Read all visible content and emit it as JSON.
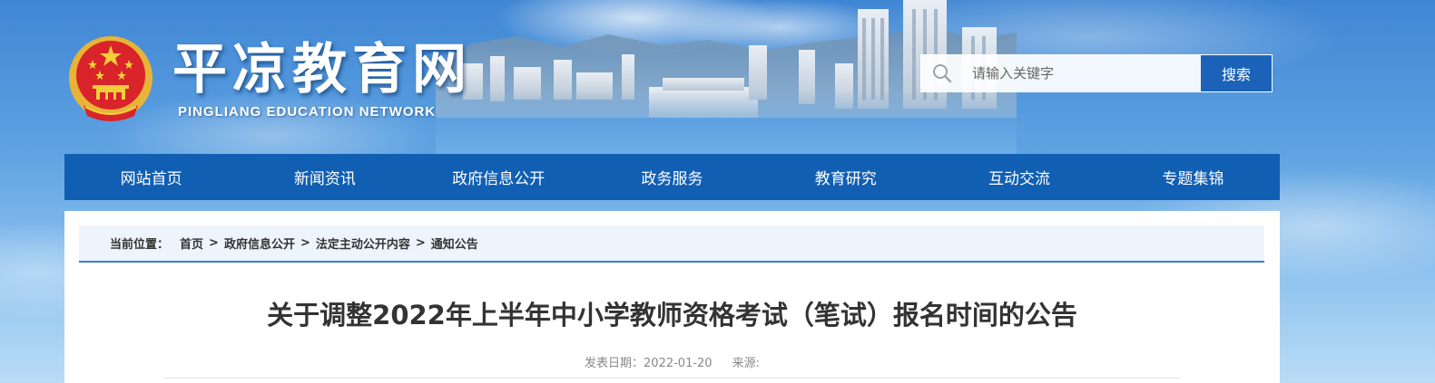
{
  "header": {
    "site_title": "平凉教育网",
    "site_subtitle": "PINGLIANG EDUCATION NETWORK",
    "emblem_icon": "national-emblem-icon"
  },
  "search": {
    "placeholder": "请输入关键字",
    "button_label": "搜索",
    "icon": "search-icon"
  },
  "nav": {
    "items": [
      {
        "label": "网站首页"
      },
      {
        "label": "新闻资讯"
      },
      {
        "label": "政府信息公开"
      },
      {
        "label": "政务服务"
      },
      {
        "label": "教育研究"
      },
      {
        "label": "互动交流"
      },
      {
        "label": "专题集锦"
      }
    ]
  },
  "breadcrumb": {
    "label": "当前位置：",
    "items": [
      "首页",
      "政府信息公开",
      "法定主动公开内容",
      "通知公告"
    ],
    "separator": ">"
  },
  "article": {
    "title": "关于调整2022年上半年中小学教师资格考试（笔试）报名时间的公告",
    "date_label": "发表日期：",
    "date": "2022-01-20",
    "source_label": "来源:"
  },
  "colors": {
    "nav_bg": "#115fb3",
    "search_button": "#1b62b8",
    "breadcrumb_bg": "#eef4fb",
    "breadcrumb_border": "#3a7cd0",
    "title_text": "#333333"
  }
}
